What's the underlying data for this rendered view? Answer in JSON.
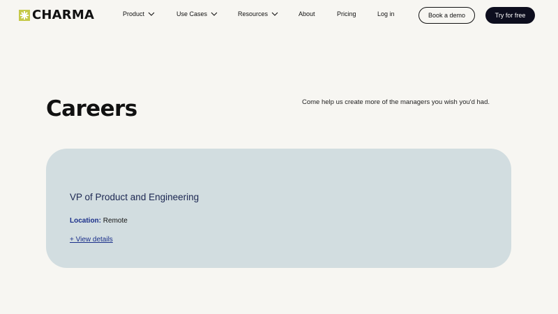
{
  "brand": {
    "name": "CHARMA",
    "mark_color": "#c6c94a"
  },
  "nav": {
    "items": [
      {
        "label": "Product",
        "has_dropdown": true
      },
      {
        "label": "Use Cases",
        "has_dropdown": true
      },
      {
        "label": "Resources",
        "has_dropdown": true
      },
      {
        "label": "About",
        "has_dropdown": false
      },
      {
        "label": "Pricing",
        "has_dropdown": false
      },
      {
        "label": "Log in",
        "has_dropdown": false
      }
    ],
    "book_demo_label": "Book a demo",
    "try_free_label": "Try for free"
  },
  "hero": {
    "title": "Careers",
    "tagline": "Come help us create more of the managers you wish you'd had."
  },
  "jobs": [
    {
      "title": "VP of Product and Engineering",
      "location_label": "Location:",
      "location_value": "Remote",
      "view_details_label": "+ View details"
    }
  ],
  "colors": {
    "background": "#f7f6f2",
    "card": "#d2dde0",
    "accent_blue": "#1a2f8a",
    "button_dark": "#0d0e1e"
  }
}
